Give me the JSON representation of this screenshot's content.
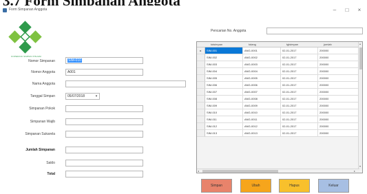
{
  "document": {
    "heading": "3.7 Form Simpanan Anggota"
  },
  "window": {
    "title": "Form Simpanan Anggota",
    "minimize_glyph": "–",
    "maximize_glyph": "□",
    "close_glyph": "×"
  },
  "logo": {
    "text": "KOPERASI SIMPAN PINJAM",
    "colors": {
      "primary": "#2e9a4b",
      "secondary": "#7fc241"
    }
  },
  "form": {
    "nomor_simpanan": {
      "label": "Nomor Simpanan",
      "value": "SIM-010"
    },
    "nomor_anggota": {
      "label": "Nomor Anggota",
      "value": "A001"
    },
    "nama_anggota": {
      "label": "Nama Anggota",
      "value": ""
    },
    "tanggal_simpan": {
      "label": "Tanggal Simpan",
      "value": "05/07/2018"
    },
    "simpanan_pokok": {
      "label": "Simpanan Pokok",
      "value": ""
    },
    "simpanan_wajib": {
      "label": "Simpanan Wajib",
      "value": ""
    },
    "simpanan_sukarela": {
      "label": "Simpanan Sukarela",
      "value": ""
    },
    "jumlah_simpanan": {
      "label": "Jumlah Simpanan",
      "value": ""
    },
    "saldo": {
      "label": "Saldo",
      "value": ""
    },
    "total": {
      "label": "Total",
      "value": ""
    }
  },
  "search": {
    "label": "Pencarian No. Anggota",
    "value": ""
  },
  "grid": {
    "columns": [
      "kdsimpan",
      "kdang",
      "tglsimpan",
      "jumlah"
    ],
    "current_row_marker": "▸",
    "rows": [
      [
        "SIM-001",
        "ANG-0001",
        "02-01-2017",
        "200000"
      ],
      [
        "SIM-002",
        "ANG-0002",
        "02-01-2017",
        "200000"
      ],
      [
        "SIM-003",
        "ANG-0003",
        "02-01-2017",
        "200000"
      ],
      [
        "SIM-004",
        "ANG-0004",
        "02-01-2017",
        "200000"
      ],
      [
        "SIM-005",
        "ANG-0005",
        "02-01-2017",
        "200000"
      ],
      [
        "SIM-006",
        "ANG-0006",
        "02-01-2017",
        "200000"
      ],
      [
        "SIM-007",
        "ANG-0007",
        "02-01-2017",
        "200000"
      ],
      [
        "SIM-008",
        "ANG-0008",
        "02-01-2017",
        "200000"
      ],
      [
        "SIM-009",
        "ANG-0009",
        "02-01-2017",
        "200000"
      ],
      [
        "SIM-010",
        "ANG-0010",
        "02-01-2017",
        "200000"
      ],
      [
        "SIM-011",
        "ANG-0011",
        "02-01-2017",
        "200000"
      ],
      [
        "SIM-012",
        "ANG-0012",
        "02-01-2017",
        "200000"
      ],
      [
        "SIM-013",
        "ANG-0013",
        "02-01-2017",
        "200000"
      ]
    ]
  },
  "buttons": [
    {
      "name": "simpan-button",
      "label": "Simpan",
      "color": "#e8836b"
    },
    {
      "name": "ubah-button",
      "label": "Ubah",
      "color": "#f6a51c"
    },
    {
      "name": "hapus-button",
      "label": "Hapus",
      "color": "#f8c02c"
    },
    {
      "name": "keluar-button",
      "label": "Keluar",
      "color": "#a7bfe3"
    }
  ]
}
